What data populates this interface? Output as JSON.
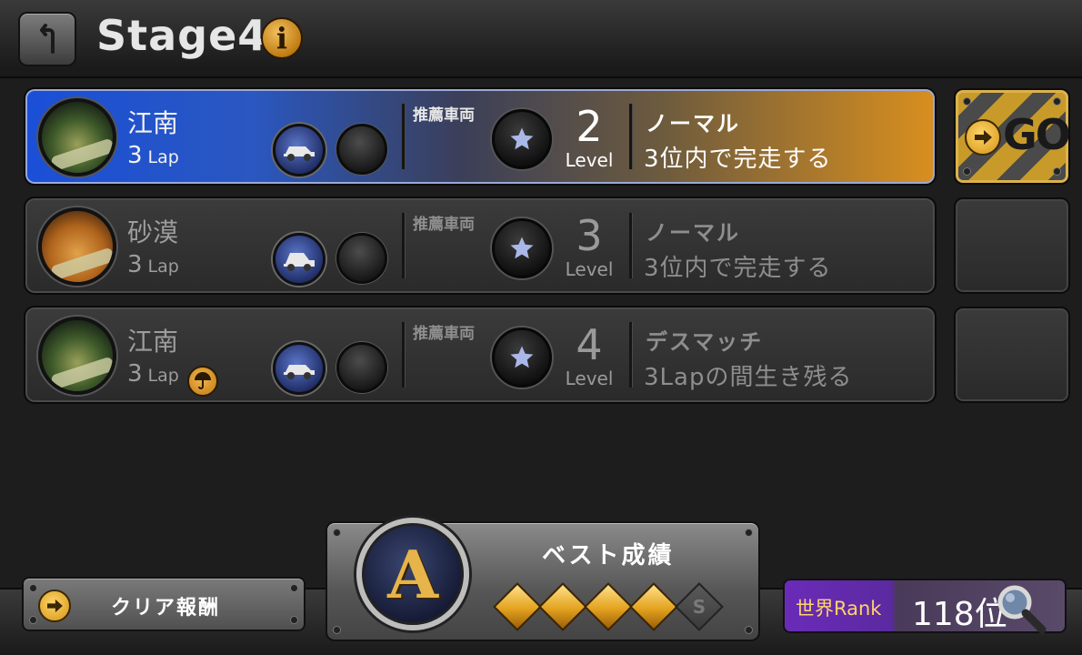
{
  "header": {
    "title": "Stage4"
  },
  "rows": [
    {
      "course": "江南",
      "laps": "3",
      "lap_unit": "Lap",
      "recommend_label": "推薦車両",
      "level": "2",
      "level_label": "Level",
      "mode": "ノーマル",
      "goal": "3位内で完走する",
      "active": true,
      "go_label": "GO"
    },
    {
      "course": "砂漠",
      "laps": "3",
      "lap_unit": "Lap",
      "recommend_label": "推薦車両",
      "level": "3",
      "level_label": "Level",
      "mode": "ノーマル",
      "goal": "3位内で完走する",
      "active": false
    },
    {
      "course": "江南",
      "laps": "3",
      "lap_unit": "Lap",
      "recommend_label": "推薦車両",
      "level": "4",
      "level_label": "Level",
      "mode": "デスマッチ",
      "goal": "3Lapの間生き残る",
      "active": false,
      "has_umbrella": true
    }
  ],
  "footer": {
    "reward_label": "クリア報酬",
    "best_label": "ベスト成績",
    "best_rank": "A",
    "gems_earned": 4,
    "gems_total": 5,
    "last_gem_letter": "S",
    "world_rank_label": "世界Rank",
    "world_rank_value": "118位"
  },
  "colors": {
    "active_row_left": "#1a4fd8",
    "active_row_right": "#d98f1f",
    "gold": "#e3a21e",
    "world_rank_bg": "#6a2bb8"
  }
}
